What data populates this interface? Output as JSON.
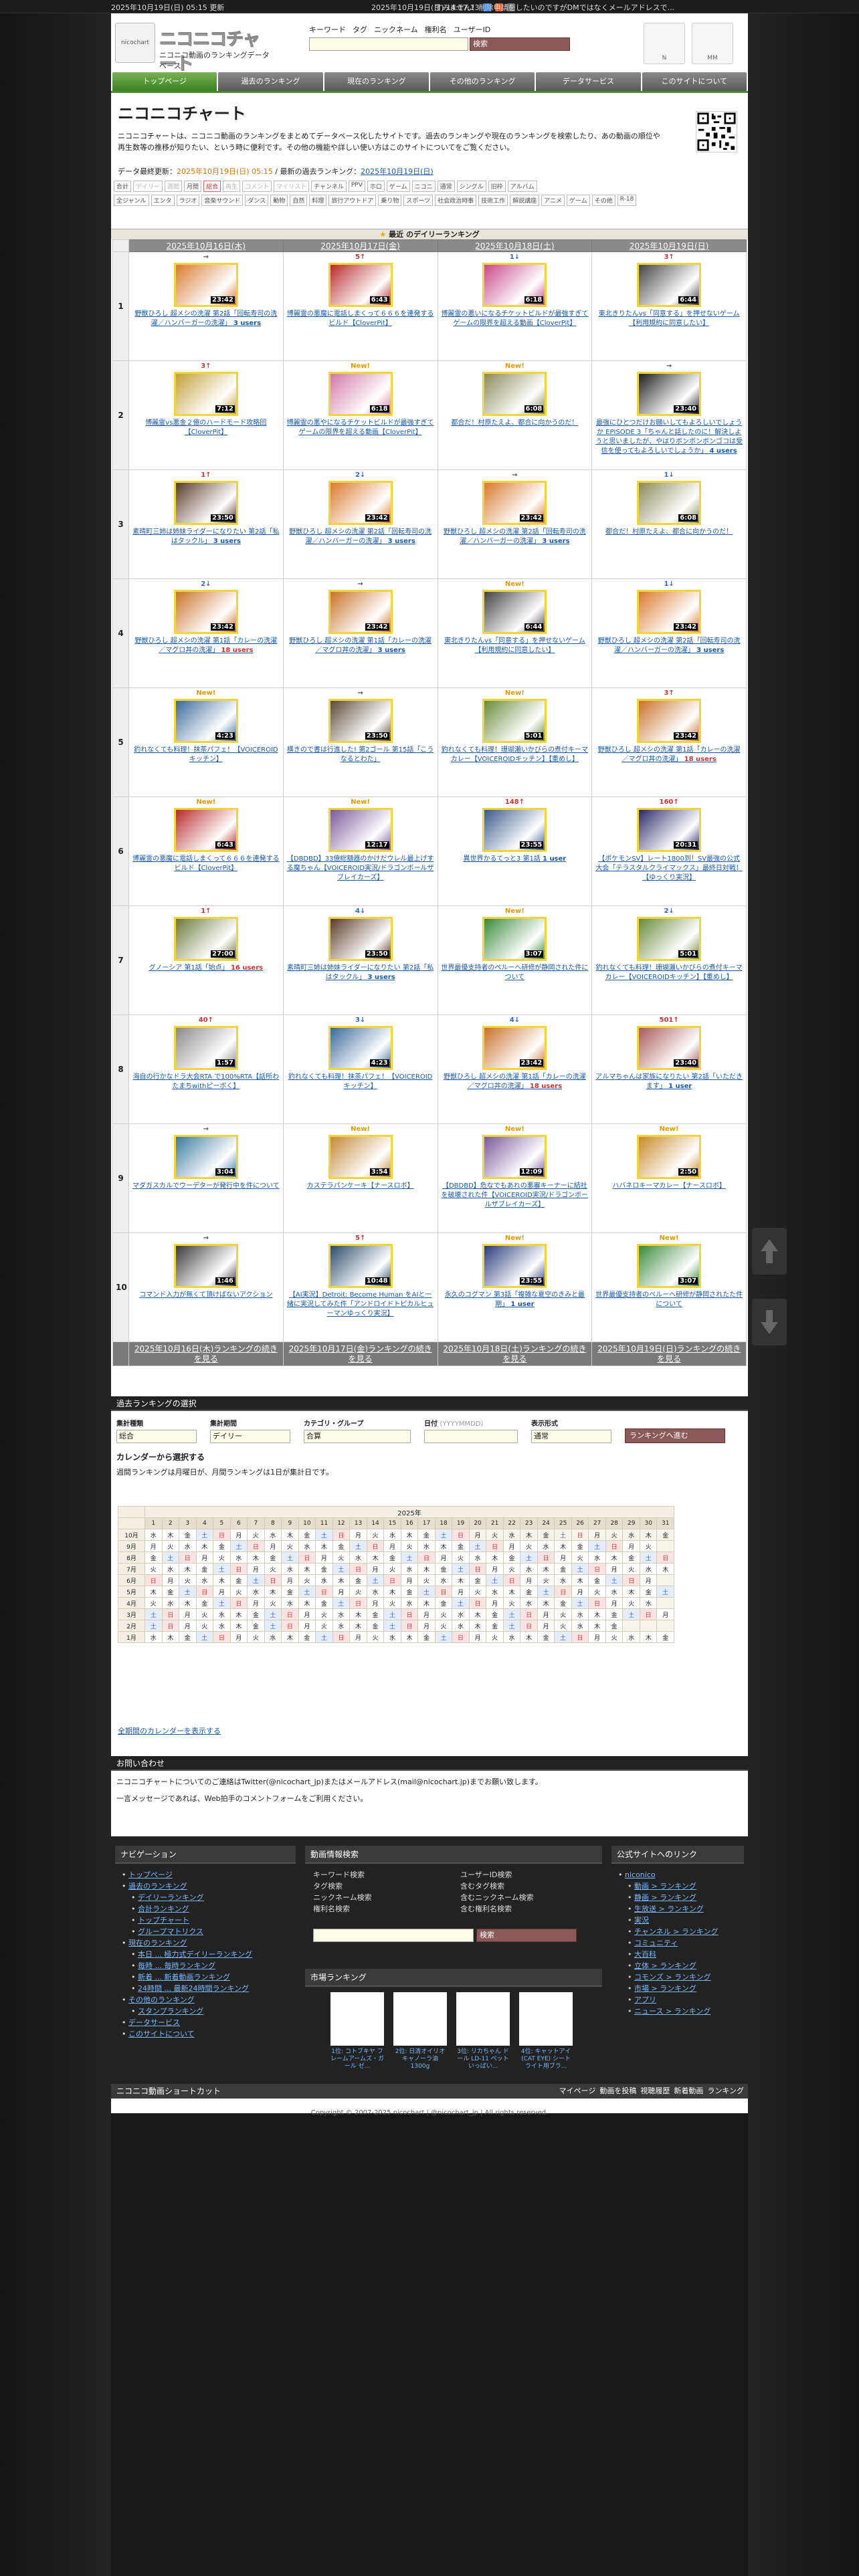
{
  "topbar": {
    "left": "2025年10月19日(日) 05:15 更新",
    "right": "2025年10月19日(日) 14:17:13",
    "msg": "すみません！削除申請をしたいのですがDMではなくメールアドレスで..."
  },
  "header": {
    "logo_title": "ニコニコチャート",
    "logo_sub": "ニコニコ動画のランキングデータベース",
    "logo_mark": "nicochart",
    "search_tabs": [
      "キーワード",
      "タグ",
      "ニックネーム",
      "権利名",
      "ユーザーID"
    ],
    "search_button": "検索",
    "side_icons": [
      "N",
      "MM"
    ]
  },
  "nav": [
    "トップページ",
    "過去のランキング",
    "現在のランキング",
    "その他のランキング",
    "データサービス",
    "このサイトについて"
  ],
  "intro": {
    "title": "ニコニコチャート",
    "p1": "ニコニコチャートは、ニコニコ動画のランキングをまとめてデータベース化したサイトです。過去のランキングや現在のランキングを検索したり、あの動画の順位や再生数等の推移が知りたい、という時に便利です。その他の機能や詳しい使い方はこのサイトについてをご覧ください。",
    "updated_label": "データ最終更新：",
    "updated_value": "2025年10月19日(日) 05:15",
    "latest_label": " / 最新の過去ランキング：",
    "latest_value": "2025年10月19日(日)"
  },
  "categories": {
    "row1": [
      "合計",
      "デイリー",
      "週間",
      "月間",
      "総合",
      "再生",
      "コメント",
      "マイリスト",
      "チャンネル",
      "PPV",
      "ホロ",
      "ゲーム",
      "ニコニ",
      "通常",
      "シングル",
      "旧枠",
      "アルバム"
    ],
    "row2": [
      "全ジャンル",
      "エンタ",
      "ラジオ",
      "音楽サウンド",
      "ダンス",
      "動物",
      "自然",
      "料理",
      "旅行アウトドア",
      "乗り物",
      "スポーツ",
      "社会政治時事",
      "技術工作",
      "解説講座",
      "アニメ",
      "ゲーム",
      "その他",
      "R-18"
    ]
  },
  "daily": {
    "head": "最近 のデイリーランキング",
    "dates": [
      "2025年10月16日(木)",
      "2025年10月17日(金)",
      "2025年10月18日(土)",
      "2025年10月19日(日)"
    ],
    "footer_links": [
      "2025年10月16日(木)ランキングの続きを見る",
      "2025年10月17日(金)ランキングの続きを見る",
      "2025年10月18日(土)ランキングの続きを見る",
      "2025年10月19日(日)ランキングの続きを見る"
    ],
    "rows": [
      [
        {
          "chg": "→",
          "t": "野獣ひろし 超メシの洗濯 第2話「回転寿司の洗濯／ハンバーガーの洗濯」",
          "u": "3 users",
          "len": "23:42",
          "c": "#d97a2f",
          "r": false
        },
        {
          "chg": "5↑",
          "t": "博麗霊の悪魔に電話しまくって６６６を連発するビルド【CloverPit】",
          "u": "",
          "len": "6:43",
          "c": "#b82a2a",
          "r": false
        },
        {
          "chg": "1↓",
          "t": "博麗霊の悪いになるチケットビルドが最強すぎてゲームの限界を超える動画【CloverPit】",
          "u": "",
          "len": "6:18",
          "c": "#c84a8a",
          "r": false
        },
        {
          "chg": "3↑",
          "t": "東北きりたんvs「同意する」を押せないゲーム【利用規約に同意したい】",
          "u": "",
          "len": "6:44",
          "c": "#444444",
          "r": false
        }
      ],
      [
        {
          "chg": "3↑",
          "t": "博麗霊vs悪金２億のハードモード攻略回【CloverPit】",
          "u": "",
          "len": "7:12",
          "c": "#c4a03a",
          "r": false
        },
        {
          "chg": "New!",
          "t": "博麗霊の悪やになるチケットビルドが最強すぎてゲームの限界を超える動画【CloverPit】",
          "u": "",
          "len": "6:18",
          "c": "#d27aa5",
          "r": false
        },
        {
          "chg": "New!",
          "t": "都合だ！村原たえよ、都合に向かうのだ！",
          "u": "",
          "len": "6:08",
          "c": "#8a8a5a",
          "r": false
        },
        {
          "chg": "→",
          "t": "最強にひとつだけお願いしてもよろしいでしょうか EPISODE 3「ちゃんと話したのに！解決しようと思いましたが、やはりボンボンボンゴコは受信を使ってもよろしいでしょうか」",
          "u": "4 users",
          "len": "23:40",
          "c": "#1f1f1f",
          "r": false
        }
      ],
      [
        {
          "chg": "1↑",
          "t": "素晴町三姉は姉妹ライダーになりたい 第2話「私はタックル」",
          "u": "3 users",
          "len": "23:50",
          "c": "#5a3a2a",
          "r": false
        },
        {
          "chg": "2↓",
          "t": "野獣ひろし 超メシの洗濯 第2話「回転寿司の洗濯／ハンバーガーの洗濯」",
          "u": "3 users",
          "len": "23:42",
          "c": "#d97a2f",
          "r": false
        },
        {
          "chg": "→",
          "t": "野獣ひろし 超メシの洗濯 第2話「回転寿司の洗濯／ハンバーガーの洗濯」",
          "u": "3 users",
          "len": "23:42",
          "c": "#d97a2f",
          "r": false
        },
        {
          "chg": "1↓",
          "t": "都合だ！村原たえよ、都合に向かうのだ！",
          "u": "",
          "len": "6:08",
          "c": "#8a8a5a",
          "r": false
        }
      ],
      [
        {
          "chg": "2↓",
          "t": "野獣ひろし 超メシの洗濯 第1話「カレーの洗濯／マグロ丼の洗濯」",
          "u": "18 users",
          "len": "23:42",
          "c": "#c9732a",
          "r": true
        },
        {
          "chg": "→",
          "t": "野獣ひろし 超メシの洗濯 第1話「カレーの洗濯／マグロ丼の洗濯」",
          "u": "3 users",
          "len": "23:42",
          "c": "#c9732a",
          "r": false
        },
        {
          "chg": "New!",
          "t": "東北きりたんvs「同意する」を押せないゲーム【利用規約に同意したい】",
          "u": "",
          "len": "6:44",
          "c": "#444444",
          "r": false
        },
        {
          "chg": "1↓",
          "t": "野獣ひろし 超メシの洗濯 第2話「回転寿司の洗濯／ハンバーガーの洗濯」",
          "u": "3 users",
          "len": "23:42",
          "c": "#d97a2f",
          "r": false
        }
      ],
      [
        {
          "chg": "New!",
          "t": "釣れなくても料理！抹茶パフェ！【VOICEROIDキッチン】",
          "u": "",
          "len": "4:23",
          "c": "#3a6a9a",
          "r": false
        },
        {
          "chg": "→",
          "t": "横きので書は行進した! 第2ゴール 第15話「こうなるとわた」",
          "u": "",
          "len": "23:50",
          "c": "#5a4a3a",
          "r": false
        },
        {
          "chg": "New!",
          "t": "釣れなくても料理！珊瑚瀬いかびらの煮付キーマカレー【VOICEROIDキッチン】【重めし】",
          "u": "",
          "len": "5:01",
          "c": "#6a8a3a",
          "r": false
        },
        {
          "chg": "3↑",
          "t": "野獣ひろし 超メシの洗濯 第1話「カレーの洗濯／マグロ丼の洗濯」",
          "u": "18 users",
          "len": "23:42",
          "c": "#c9732a",
          "r": true
        }
      ],
      [
        {
          "chg": "New!",
          "t": "博麗霊の悪魔に電話しまくって６６６を連発するビルド【CloverPit】",
          "u": "",
          "len": "6:43",
          "c": "#b82a2a",
          "r": false
        },
        {
          "chg": "New!",
          "t": "【DBDBD】33億総額器のかけだウレル最上げする魔ちゃん【VOICEROID実況/ドラゴンボールザブレイカーズ】",
          "u": "",
          "len": "12:17",
          "c": "#7a5a9a",
          "r": false
        },
        {
          "chg": "148↑",
          "t": "異世界かるてっと3 第1話",
          "u": "1 user",
          "len": "23:55",
          "c": "#3a5a8a",
          "r": false
        },
        {
          "chg": "160↑",
          "t": "【ポケモンSV】レート1800到！SV最強の公式大会「テラスタルクライマックス」最終日対戦！【ゆっくり実況】",
          "u": "",
          "len": "20:31",
          "c": "#2a2a6a",
          "r": false
        }
      ],
      [
        {
          "chg": "1↑",
          "t": "グノーシア 第1話「始点」",
          "u": "16 users",
          "len": "27:00",
          "c": "#6a7a3a",
          "r": true
        },
        {
          "chg": "4↓",
          "t": "素晴町三姉は姉妹ライダーになりたい 第2話「私はタックル」",
          "u": "3 users",
          "len": "23:50",
          "c": "#5a3a2a",
          "r": false
        },
        {
          "chg": "New!",
          "t": "世界最優支持者のペルーヘ研修が静岡された件について",
          "u": "",
          "len": "3:07",
          "c": "#3a8a3a",
          "r": false
        },
        {
          "chg": "2↓",
          "t": "釣れなくても料理！珊瑚瀬いかびらの煮付キーマカレー【VOICEROIDキッチン】【重めし】",
          "u": "",
          "len": "5:01",
          "c": "#6a8a3a",
          "r": false
        }
      ],
      [
        {
          "chg": "40↑",
          "t": "海自の行かなドラ大会RTA で100%RTA【話所わたまちwithピーボく】",
          "u": "",
          "len": "1:57",
          "c": "#8a8a8a",
          "r": false
        },
        {
          "chg": "3↓",
          "t": "釣れなくても料理！抹茶パフェ！【VOICEROIDキッチン】",
          "u": "",
          "len": "4:23",
          "c": "#3a6a9a",
          "r": false
        },
        {
          "chg": "4↓",
          "t": "野獣ひろし 超メシの洗濯 第1話「カレーの洗濯／マグロ丼の洗濯」",
          "u": "18 users",
          "len": "23:42",
          "c": "#c9732a",
          "r": true
        },
        {
          "chg": "501↑",
          "t": "アルマちゃんは家族になりたい 第2話「いただきます」",
          "u": "1 user",
          "len": "23:40",
          "c": "#a85a5a",
          "r": false
        }
      ],
      [
        {
          "chg": "→",
          "t": "マダガスカルでウーデターが発行中を件について",
          "u": "",
          "len": "3:04",
          "c": "#3a7aa0",
          "r": false
        },
        {
          "chg": "New!",
          "t": "カステラパンケーキ【ナースロボ】",
          "u": "",
          "len": "3:54",
          "c": "#c48a3a",
          "r": false
        },
        {
          "chg": "New!",
          "t": "【DBDBD】危なでもあれの悪審キーナーに結社を破壊された件【VOICEROID実況/ドラゴンボールザブレイカーズ】",
          "u": "",
          "len": "12:09",
          "c": "#7a5a9a",
          "r": false
        },
        {
          "chg": "New!",
          "t": "ハバネロキーマカレー【ナースロボ】",
          "u": "",
          "len": "2:50",
          "c": "#c88a2a",
          "r": false
        }
      ],
      [
        {
          "chg": "→",
          "t": "コマンド入力が無くて頂けばないアクション",
          "u": "",
          "len": "1:46",
          "c": "#3a3a3a",
          "r": false
        },
        {
          "chg": "5↑",
          "t": "【AI実況】Detroit: Become Human をAIと一緒に実況してみた件「アンドロイドトピカルヒューマンゆっくり実況】",
          "u": "",
          "len": "10:48",
          "c": "#2a4a6a",
          "r": false
        },
        {
          "chg": "New!",
          "t": "永久のコグマン 第3話「複雑な夏空のきみと最期」",
          "u": "1 user",
          "len": "23:55",
          "c": "#2a3a7a",
          "r": false
        },
        {
          "chg": "New!",
          "t": "世界最優支持者のペルーヘ研修が静岡されたた件について",
          "u": "",
          "len": "3:07",
          "c": "#3a8a3a",
          "r": false
        }
      ]
    ]
  },
  "past": {
    "title": "過去ランキングの選択",
    "labels": [
      "集計種類",
      "集計期間",
      "カテゴリ・グループ",
      "日付",
      "表示形式"
    ],
    "date_hint": "(YYYYMMDD)",
    "values": [
      "総合",
      "デイリー",
      "合算",
      "",
      "通常"
    ],
    "go": "ランキングへ進む",
    "cal_title": "カレンダーから選択する",
    "cal_note": "週間ランキングは月曜日が、月間ランキングは1日が集計日です。",
    "year": "2025年",
    "months": [
      "10月",
      "9月",
      "8月",
      "7月",
      "6月",
      "5月",
      "4月",
      "3月",
      "2月",
      "1月"
    ],
    "more": "全期間のカレンダーを表示する"
  },
  "contact": {
    "title": "お問い合わせ",
    "p1": "ニコニコチャートについてのご連絡はTwitter(@nicochart_jp)またはメールアドレス(mail@nicochart.jp)までお願い致します。",
    "p2": "一言メッセージであれば、Web拍手のコメントフォームをご利用ください。"
  },
  "footer": {
    "nav_title": "ナビゲーション",
    "nav": [
      {
        "t": "トップページ",
        "c": ""
      },
      {
        "t": "過去のランキング",
        "c": ""
      },
      {
        "t": "デイリーランキング",
        "c": "sub"
      },
      {
        "t": "合計ランキング",
        "c": "sub"
      },
      {
        "t": "トップチャート",
        "c": "sub"
      },
      {
        "t": "グループマトリクス",
        "c": "sub"
      },
      {
        "t": "現在のランキング",
        "c": ""
      },
      {
        "t": "本日 ... 極力式デイリーランキング",
        "c": "sub"
      },
      {
        "t": "毎時 ... 毎時ランキング",
        "c": "sub"
      },
      {
        "t": "新着 ... 新着動画ランキング",
        "c": "sub"
      },
      {
        "t": "24時間 ... 最新24時間ランキング",
        "c": "sub"
      },
      {
        "t": "その他のランキング",
        "c": ""
      },
      {
        "t": "スタンプランキング",
        "c": "sub"
      },
      {
        "t": "データサービス",
        "c": ""
      },
      {
        "t": "このサイトについて",
        "c": ""
      }
    ],
    "search_title": "動画情報検索",
    "search_items": [
      "キーワード検索",
      "ユーザーID検索",
      "タグ検索",
      "含むタグ検索",
      "ニックネーム検索",
      "含むニックネーム検索",
      "権利名検索",
      "含む権利名検索"
    ],
    "search_button": "検索",
    "shop_title": "市場ランキング",
    "shop_items": [
      "1位: コトブキヤ フレームアームズ・ガール ゼ...",
      "2位: 日清オイリオ キャノーラ油 1300g",
      "3位: リカちゃん ドール LD-11 ペットいっぱい...",
      "4位: キャットアイ(CAT EYE) シートライト用ブラ..."
    ],
    "official_title": "公式サイトへのリンク",
    "official": [
      "niconico",
      "動画 > ランキング",
      "静画 > ランキング",
      "生放送 > ランキング",
      "実況",
      "チャンネル > ランキング",
      "コミュニティ",
      "大百科",
      "立体 > ランキング",
      "コモンズ > ランキング",
      "市場 > ランキング",
      "アプリ",
      "ニュース > ランキング"
    ],
    "shortcut_title": "ニコニコ動画ショートカット",
    "shortcut_links": [
      "マイページ",
      "動画を投稿",
      "視聴履歴",
      "新着動画",
      "ランキング"
    ],
    "copyright": "Copyright © 2007-2025 nicochart | @nicochart_jp | All rights reserved."
  }
}
